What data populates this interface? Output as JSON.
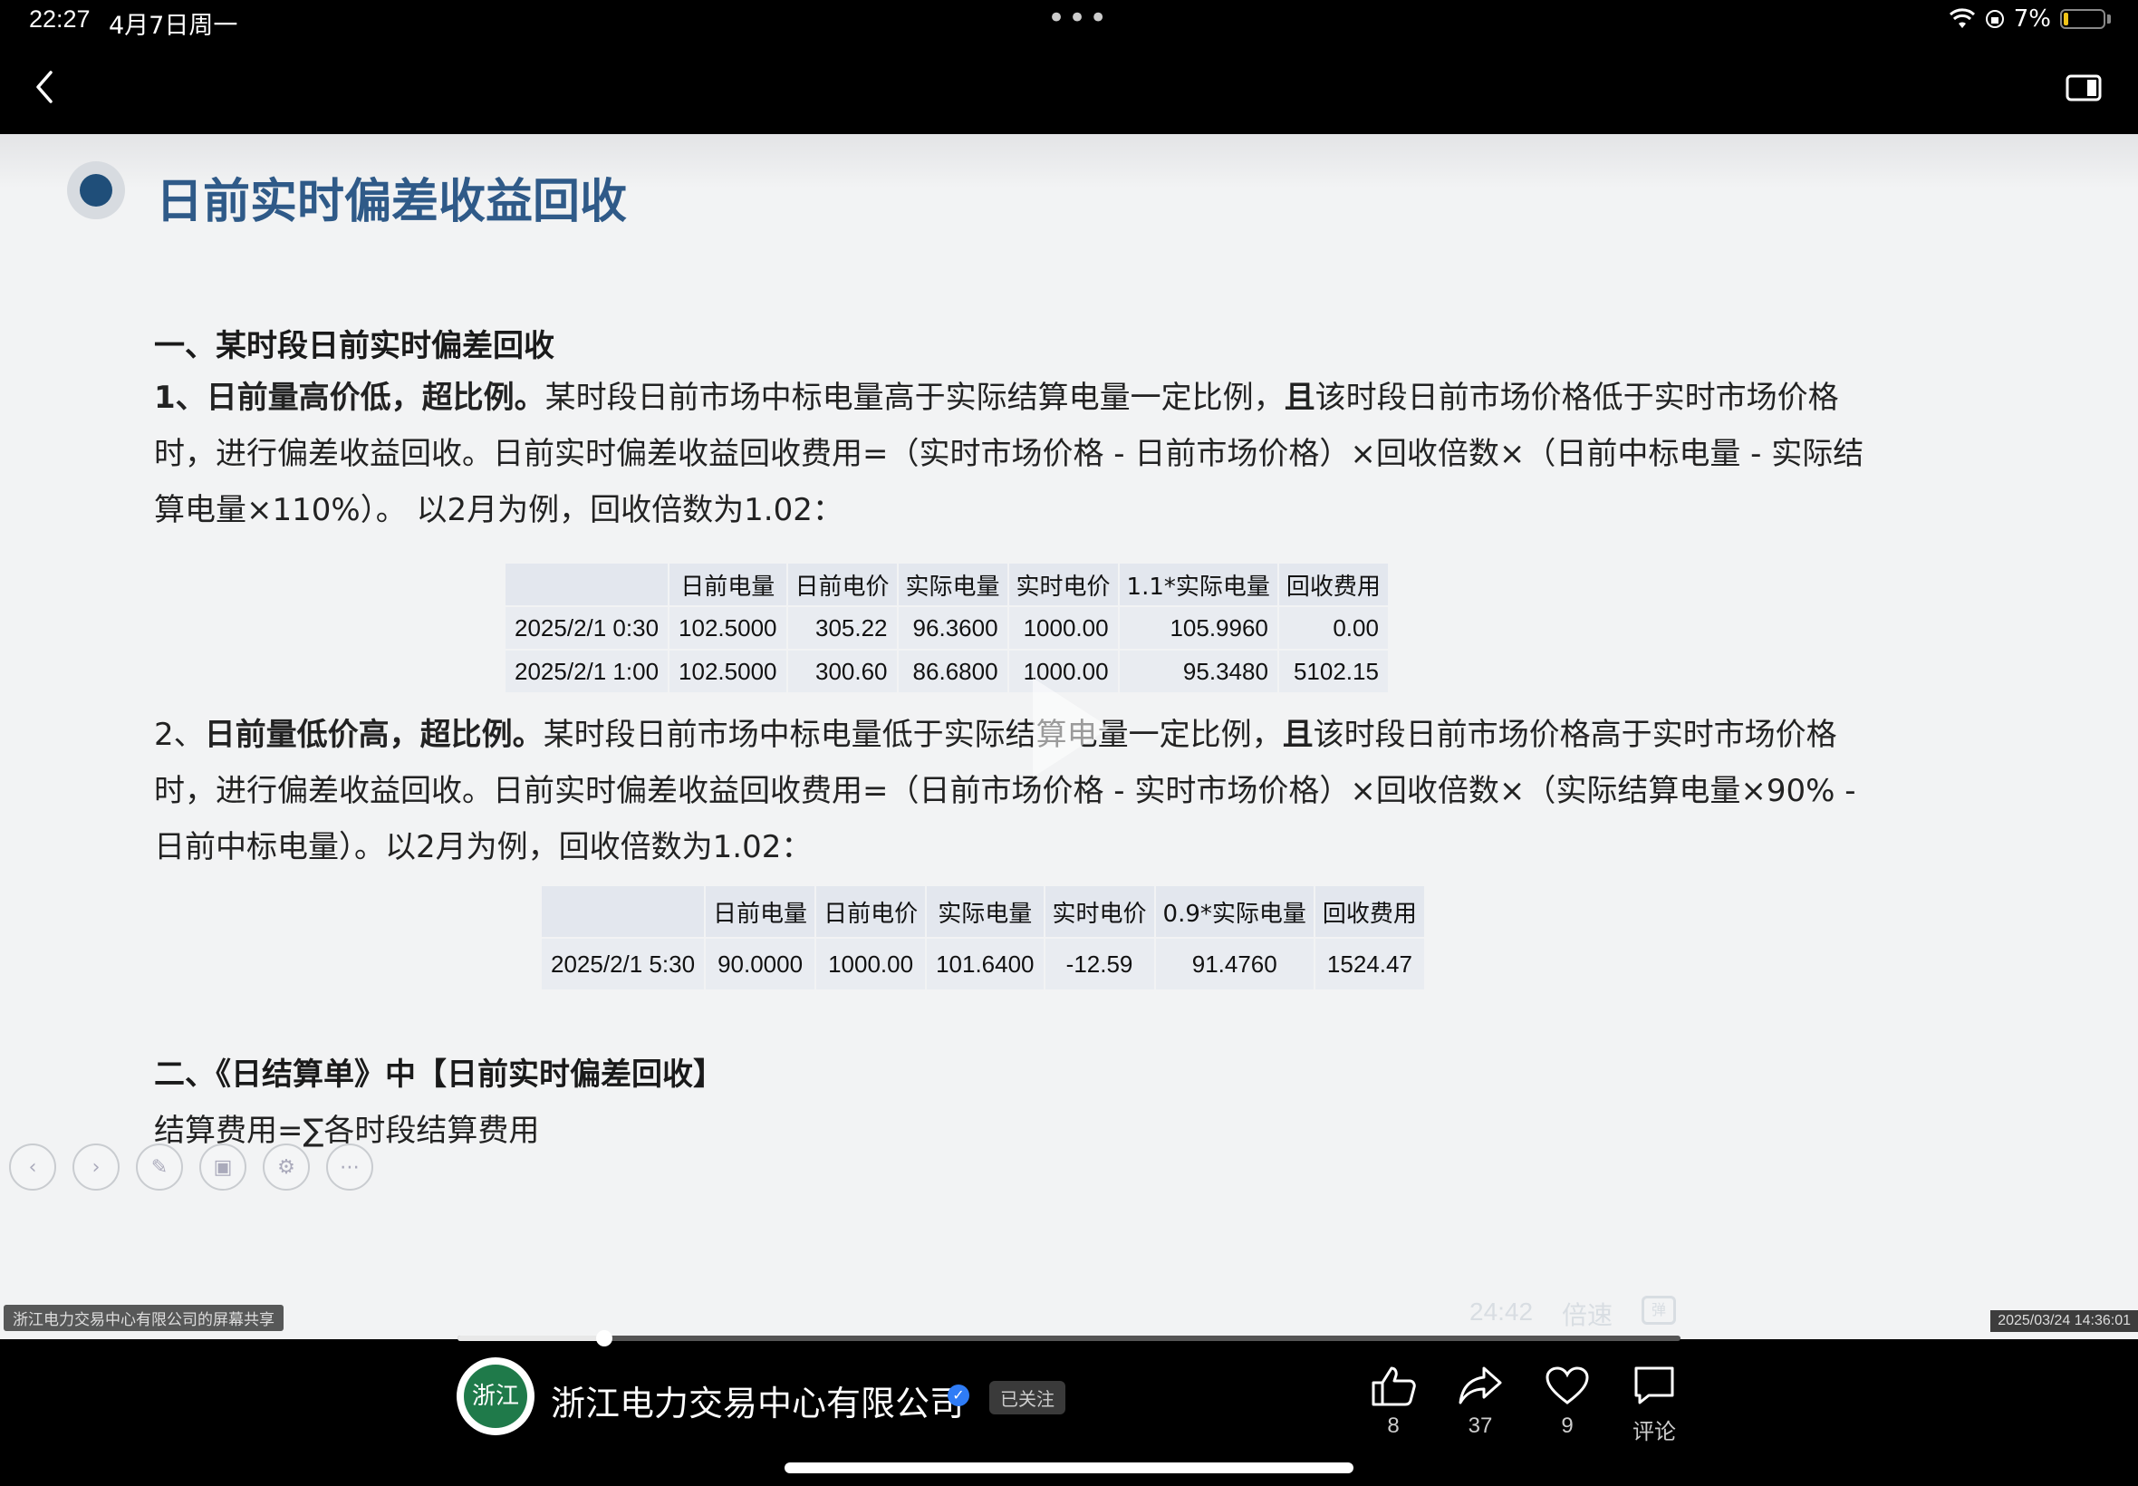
{
  "status_bar": {
    "time": "22:27",
    "date": "4月7日周一",
    "battery": "7%"
  },
  "slide": {
    "title": "日前实时偏差收益回收",
    "section1_heading": "一、某时段日前实时偏差回收",
    "item1": {
      "number": "1、",
      "bold": "日前量高价低，超比例。",
      "text_a": "某时段日前市场中标电量高于实际结算电量一定比例，",
      "bold2": "且",
      "text_b": "该时段日前市场价格低于实时市场价格时，进行偏差收益回收。日前实时偏差收益回收费用=（实时市场价格 - 日前市场价格）×回收倍数×（日前中标电量 - 实际结算电量×110%）。 以2月为例，回收倍数为1.02："
    },
    "table1": {
      "headers": [
        "",
        "日前电量",
        "日前电价",
        "实际电量",
        "实时电价",
        "1.1*实际电量",
        "回收费用"
      ],
      "rows": [
        [
          "2025/2/1 0:30",
          "102.5000",
          "305.22",
          "96.3600",
          "1000.00",
          "105.9960",
          "0.00"
        ],
        [
          "2025/2/1 1:00",
          "102.5000",
          "300.60",
          "86.6800",
          "1000.00",
          "95.3480",
          "5102.15"
        ]
      ]
    },
    "item2": {
      "number": "2、",
      "bold": "日前量低价高，超比例。",
      "text_a": "某时段日前市场中标电量低于实际结算电量一定比例，",
      "bold2": "且",
      "text_b": "该时段日前市场价格高于实时市场价格时，进行偏差收益回收。日前实时偏差收益回收费用=（日前市场价格 - 实时市场价格）×回收倍数×（实际结算电量×90% - 日前中标电量）。以2月为例，回收倍数为1.02："
    },
    "table2": {
      "headers": [
        "",
        "日前电量",
        "日前电价",
        "实际电量",
        "实时电价",
        "0.9*实际电量",
        "回收费用"
      ],
      "rows": [
        [
          "2025/2/1 5:30",
          "90.0000",
          "1000.00",
          "101.6400",
          "-12.59",
          "91.4760",
          "1524.47"
        ]
      ]
    },
    "section2_heading": "二、《日结算单》中【日前实时偏差回收】",
    "formula": "结算费用=∑各时段结算费用"
  },
  "player": {
    "share_label": "浙江电力交易中心有限公司的屏幕共享",
    "duration": "24:42",
    "speed_label": "倍速",
    "timestamp": "2025/03/24 14:36:01",
    "progress": 0.12
  },
  "bottom": {
    "avatar_text": "浙江",
    "channel_name": "浙江电力交易中心有限公司",
    "follow_label": "已关注",
    "like_count": "8",
    "share_count": "37",
    "favorite_count": "9",
    "comment_label": "评论"
  },
  "icons": [
    "back-icon",
    "sidebar-icon",
    "wifi-icon",
    "battery-icon",
    "play-icon",
    "like-icon",
    "share-icon",
    "heart-icon",
    "comment-icon",
    "verified-icon"
  ]
}
